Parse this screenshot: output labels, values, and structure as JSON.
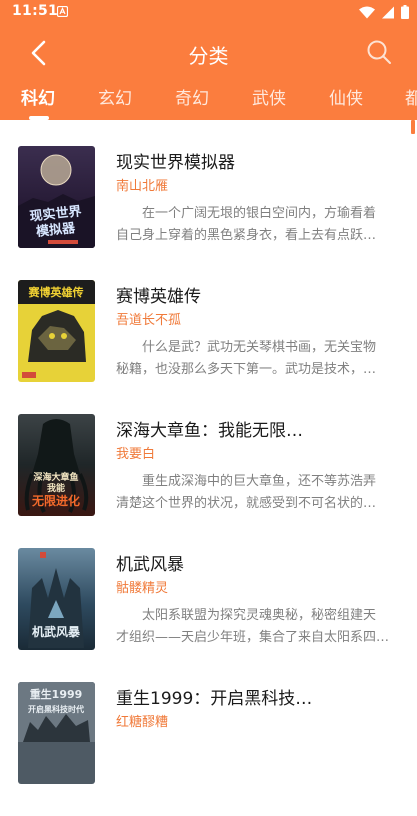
{
  "status_bar": {
    "time": "11:51"
  },
  "toolbar": {
    "title": "分类"
  },
  "tabs": [
    {
      "label": "科幻",
      "active": true
    },
    {
      "label": "玄幻",
      "active": false
    },
    {
      "label": "奇幻",
      "active": false
    },
    {
      "label": "武侠",
      "active": false
    },
    {
      "label": "仙侠",
      "active": false
    },
    {
      "label": "都",
      "active": false
    }
  ],
  "books": [
    {
      "title": "现实世界模拟器",
      "author": "南山北雁",
      "desc_line1": "在一个广阔无垠的银白空间内，方瑜看着",
      "desc_line2": "自己身上穿着的黑色紧身衣，看上去有点跃…",
      "cover_text": "现实世界\n模拟器"
    },
    {
      "title": "赛博英雄传",
      "author": "吾道长不孤",
      "desc_line1": "什么是武？武功无关琴棋书画，无关宝物",
      "desc_line2": "秘籍，也没那么多天下第一。武功是技术，…",
      "cover_text": "赛博英雄传"
    },
    {
      "title": "深海大章鱼：我能无限…",
      "author": "我要白",
      "desc_line1": "重生成深海中的巨大章鱼，还不等苏浩弄",
      "desc_line2": "清楚这个世界的状况，就感受到不可名状的…",
      "cover_text": "深海大章鱼\n我能\n无限进化"
    },
    {
      "title": "机武风暴",
      "author": "骷髅精灵",
      "desc_line1": "太阳系联盟为探究灵魂奥秘，秘密组建天",
      "desc_line2": "才组织——天启少年班，集合了来自太阳系四…",
      "cover_text": "机武风暴"
    },
    {
      "title": "重生1999：开启黑科技…",
      "author": "红糖醪糟",
      "desc_line1": "",
      "desc_line2": "",
      "cover_text": "重生1999\n开启黑科技时代"
    }
  ],
  "colors": {
    "accent": "#fb7d3e",
    "author": "#f07a3a"
  }
}
